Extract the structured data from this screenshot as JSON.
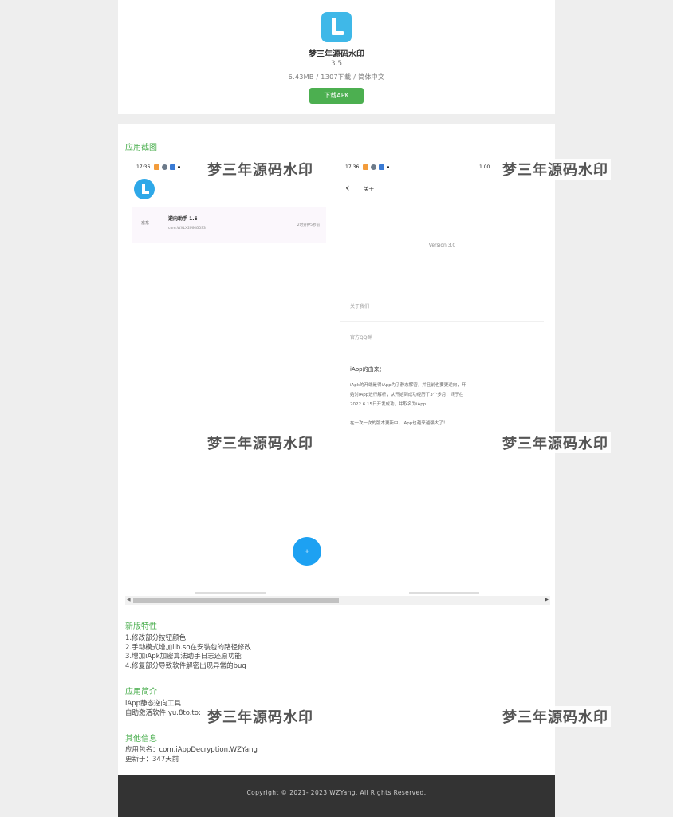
{
  "app": {
    "name": "梦三年源码水印",
    "version": "3.5",
    "meta": "6.43MB / 1307下载 / 简体中文",
    "download_label": "下载APK",
    "icon_color": "#3fb8e8"
  },
  "screenshots": {
    "title": "应用截图",
    "shot1": {
      "status_time": "17:36",
      "card_thumb": "京东",
      "card_name": "逆向助手 1.5",
      "card_pkg": "com.WXLX2MMG5S3",
      "card_time": "2时分钟5秒前",
      "fab_label": "+"
    },
    "shot2": {
      "status_time": "17:36",
      "status_right": "1.00",
      "title": "关于",
      "version": "Version 3.0",
      "item_about": "关于我们",
      "item_qq": "官方QQ群",
      "history_head": "iApp的由来：",
      "history_body": "iApk的开端是得iApp为了静态解密，并且前也要更逆向，开\n始对iApp进行解析，从开始到成功经历了3个多月，终于在\n2022.6.15日开发成功，并取名为iApp\n\n在一次一次的版本更新中，iApp也越来越强大了！"
    }
  },
  "new_features": {
    "title": "新版特性",
    "text": "1.修改部分按钮颜色\n2.手动模式增加lib.so在安装包的路径修改\n3.增加iApk加密算法助手日志还原功能\n4.修复部分导致软件解密出现异常的bug"
  },
  "intro": {
    "title": "应用简介",
    "text": "iApp静态逆向工具\n自助激活软件:yu.8to.to:"
  },
  "other": {
    "title": "其他信息",
    "text": "应用包名：com.iAppDecryption.WZYang\n更新于：347天前"
  },
  "footer": {
    "copyright": "Copyright © 2021- 2023 WZYang, All Rights Reserved."
  },
  "watermark": "梦三年源码水印"
}
